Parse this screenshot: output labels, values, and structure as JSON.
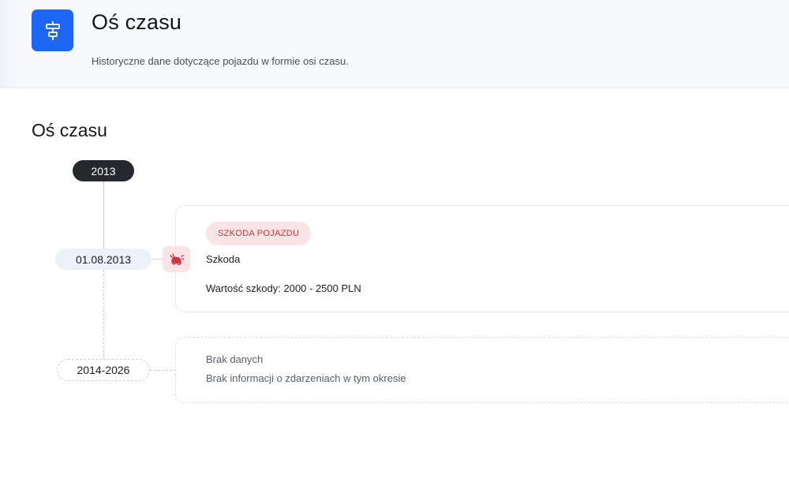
{
  "header": {
    "icon": "timeline-icon",
    "title": "Oś czasu",
    "subtitle": "Historyczne dane dotyczące pojazdu w formie osi czasu."
  },
  "section": {
    "title": "Oś czasu"
  },
  "timeline": {
    "year_label": "2013",
    "event": {
      "date": "01.08.2013",
      "icon": "car-crash-icon",
      "badge": "SZKODA POJAZDU",
      "title": "Szkoda",
      "value_text": "Wartość szkody: 2000 - 2500 PLN"
    },
    "empty_period": {
      "range": "2014-2026",
      "title": "Brak danych",
      "description": "Brak informacji o zdarzeniach w tym okresie"
    }
  },
  "colors": {
    "accent": "#1c67f6",
    "year_pill": "#25292e",
    "damage_badge_bg": "#fbe4e5",
    "damage_badge_text": "#d8333b"
  }
}
